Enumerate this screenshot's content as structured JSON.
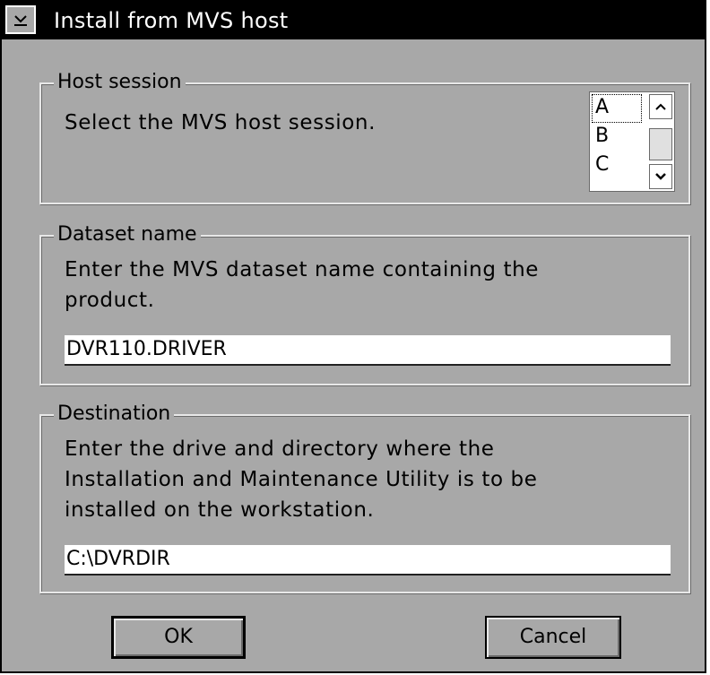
{
  "window": {
    "title": "Install from MVS host",
    "system_menu_icon": "system-menu-icon"
  },
  "host_session": {
    "legend": "Host session",
    "description": "Select the MVS host session.",
    "list": {
      "items": [
        "A",
        "B",
        "C"
      ],
      "selected": "A"
    }
  },
  "dataset": {
    "legend": "Dataset name",
    "description_line1": "Enter the MVS dataset name containing the",
    "description_line2": "product.",
    "value": "DVR110.DRIVER"
  },
  "destination": {
    "legend": "Destination",
    "description_line1": "Enter the drive and directory where the",
    "description_line2": "Installation and Maintenance Utility is to be",
    "description_line3": "installed on the workstation.",
    "value": "C:\\DVRDIR"
  },
  "buttons": {
    "ok": "OK",
    "cancel": "Cancel"
  },
  "colors": {
    "window_background": "#a8a8a8",
    "titlebar_background": "#000000",
    "titlebar_text": "#ffffff",
    "field_background": "#ffffff"
  }
}
